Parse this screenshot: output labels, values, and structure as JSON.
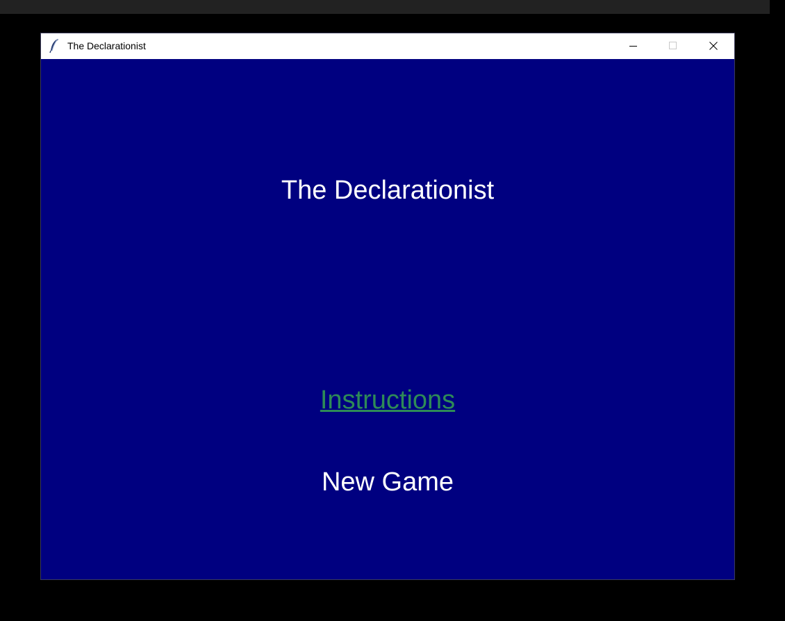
{
  "window": {
    "title": "The Declarationist",
    "icon": "feather-icon",
    "controls": {
      "minimize_icon": "minimize-icon",
      "maximize_icon": "maximize-icon",
      "close_icon": "close-icon"
    }
  },
  "menu": {
    "title": "The Declarationist",
    "instructions_label": "Instructions",
    "new_game_label": "New Game"
  },
  "colors": {
    "background": "#000080",
    "title_text": "#ffffff",
    "link_text": "#2e8b57",
    "button_text": "#ffffff"
  }
}
